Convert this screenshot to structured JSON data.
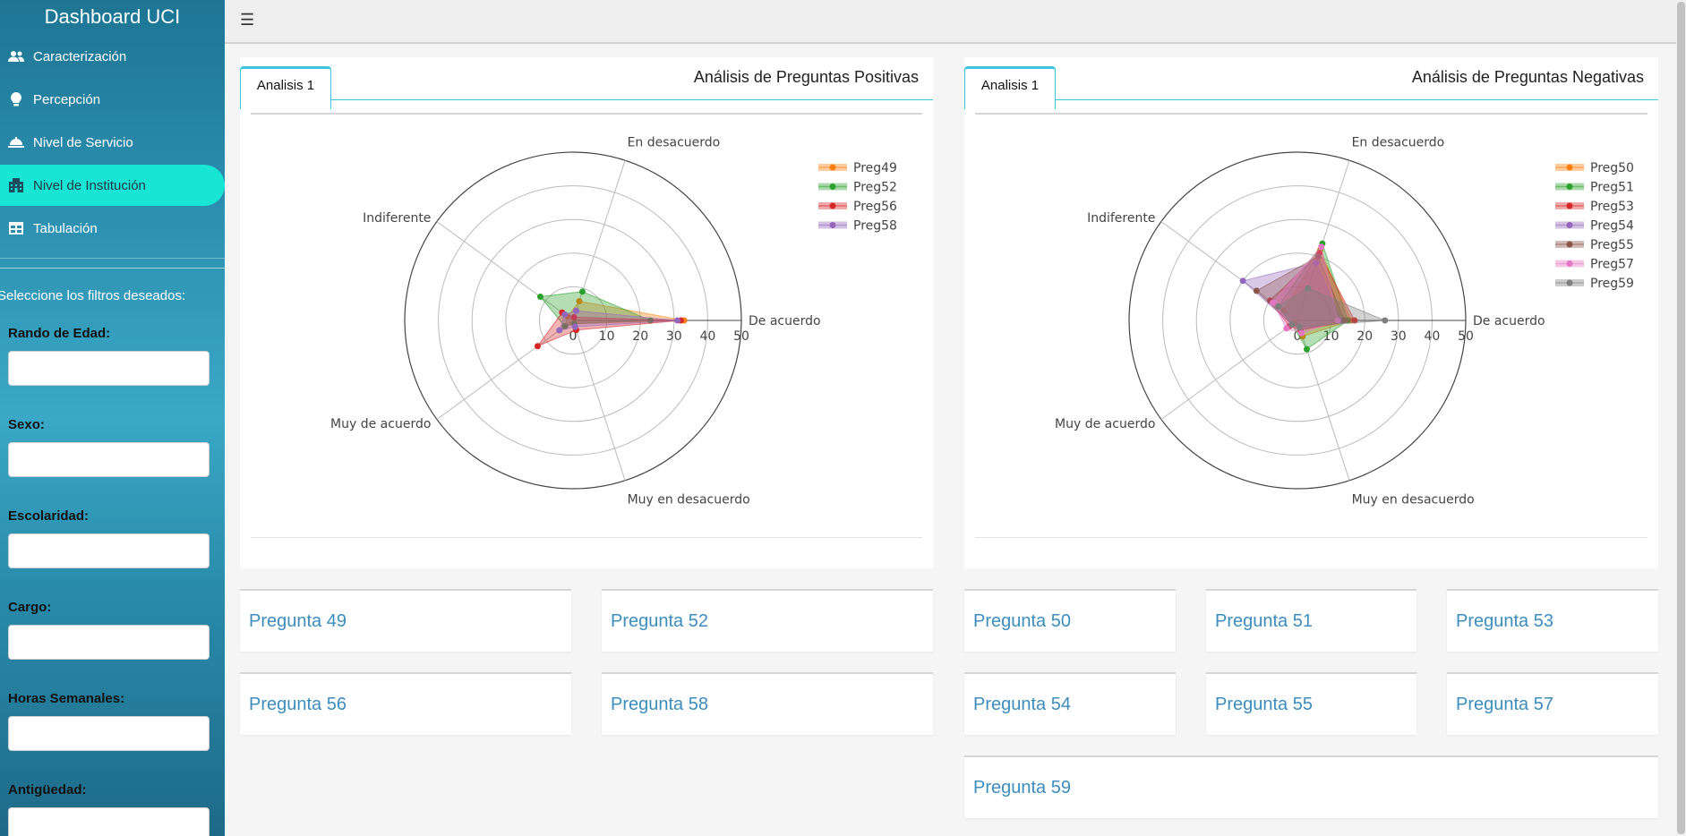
{
  "app": {
    "title": "Dashboard UCI"
  },
  "sidebar": {
    "items": [
      {
        "label": "Caracterización",
        "icon": "users-icon"
      },
      {
        "label": "Percepción",
        "icon": "lightbulb-icon"
      },
      {
        "label": "Nivel de Servicio",
        "icon": "service-bell-icon"
      },
      {
        "label": "Nivel de Institución",
        "icon": "building-icon",
        "active": true
      },
      {
        "label": "Tabulación",
        "icon": "table-icon"
      }
    ],
    "filters_title": "Seleccione los filtros deseados:",
    "filters": [
      {
        "label": "Rando de Edad:",
        "value": ""
      },
      {
        "label": "Sexo:",
        "value": ""
      },
      {
        "label": "Escolaridad:",
        "value": ""
      },
      {
        "label": "Cargo:",
        "value": ""
      },
      {
        "label": "Horas Semanales:",
        "value": ""
      },
      {
        "label": "Antigüedad:",
        "value": ""
      }
    ]
  },
  "topbar": {
    "menu_icon": "hamburger-icon"
  },
  "panels": {
    "positive": {
      "tab": "Analisis 1",
      "title": "Análisis de Preguntas Positivas"
    },
    "negative": {
      "tab": "Analisis 1",
      "title": "Análisis de Preguntas Negativas"
    }
  },
  "chart_data": [
    {
      "type": "radar",
      "title": "",
      "axes": [
        "De acuerdo",
        "En desacuerdo",
        "Indiferente",
        "Muy de acuerdo",
        "Muy en desacuerdo"
      ],
      "radial_ticks": [
        0,
        10,
        20,
        30,
        40,
        50
      ],
      "rlim": [
        0,
        50
      ],
      "legend_placement": "top-right",
      "series": [
        {
          "name": "Preg49",
          "color": "#ff7f0e",
          "values": [
            33,
            6,
            2,
            3,
            1
          ]
        },
        {
          "name": "Preg52",
          "color": "#2ca02c",
          "values": [
            23,
            9,
            12,
            3,
            1
          ]
        },
        {
          "name": "Preg56",
          "color": "#d62728",
          "values": [
            32,
            1,
            4,
            13,
            3
          ]
        },
        {
          "name": "Preg58",
          "color": "#9467bd",
          "values": [
            31,
            3,
            3,
            5,
            2
          ]
        }
      ]
    },
    {
      "type": "radar",
      "title": "",
      "axes": [
        "De acuerdo",
        "En desacuerdo",
        "Indiferente",
        "Muy de acuerdo",
        "Muy en desacuerdo"
      ],
      "radial_ticks": [
        0,
        10,
        20,
        30,
        40,
        50
      ],
      "rlim": [
        0,
        50
      ],
      "legend_placement": "top-right",
      "series": [
        {
          "name": "Preg50",
          "color": "#ff7f0e",
          "values": [
            16,
            22,
            5,
            1,
            5
          ]
        },
        {
          "name": "Preg51",
          "color": "#2ca02c",
          "values": [
            15,
            24,
            7,
            2,
            9
          ]
        },
        {
          "name": "Preg53",
          "color": "#d62728",
          "values": [
            17,
            21,
            10,
            3,
            3
          ]
        },
        {
          "name": "Preg54",
          "color": "#9467bd",
          "values": [
            13,
            18,
            20,
            2,
            3
          ]
        },
        {
          "name": "Preg55",
          "color": "#8c564b",
          "values": [
            14,
            20,
            15,
            2,
            3
          ]
        },
        {
          "name": "Preg57",
          "color": "#e377c2",
          "values": [
            12,
            23,
            9,
            4,
            4
          ]
        },
        {
          "name": "Preg59",
          "color": "#7f7f7f",
          "values": [
            26,
            10,
            7,
            2,
            2
          ]
        }
      ]
    }
  ],
  "questions_positive": [
    "Pregunta 49",
    "Pregunta 52",
    "Pregunta 56",
    "Pregunta 58"
  ],
  "questions_negative": [
    "Pregunta 50",
    "Pregunta 51",
    "Pregunta 53",
    "Pregunta 54",
    "Pregunta 55",
    "Pregunta 57",
    "Pregunta 59"
  ]
}
